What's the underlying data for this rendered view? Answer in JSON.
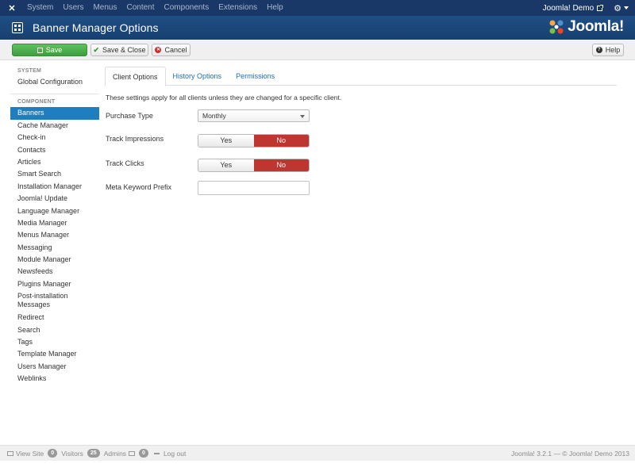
{
  "navbar": {
    "menu": [
      "System",
      "Users",
      "Menus",
      "Content",
      "Components",
      "Extensions",
      "Help"
    ],
    "site_link": "Joomla! Demo"
  },
  "header": {
    "title": "Banner Manager Options",
    "brand": "Joomla!"
  },
  "toolbar": {
    "save": "Save",
    "save_close": "Save & Close",
    "cancel": "Cancel",
    "help": "Help"
  },
  "sidebar": {
    "system_heading": "SYSTEM",
    "system_items": [
      "Global Configuration"
    ],
    "component_heading": "COMPONENT",
    "components": [
      "Banners",
      "Cache Manager",
      "Check-in",
      "Contacts",
      "Articles",
      "Smart Search",
      "Installation Manager",
      "Joomla! Update",
      "Language Manager",
      "Media Manager",
      "Menus Manager",
      "Messaging",
      "Module Manager",
      "Newsfeeds",
      "Plugins Manager",
      "Post-installation Messages",
      "Redirect",
      "Search",
      "Tags",
      "Template Manager",
      "Users Manager",
      "Weblinks"
    ],
    "active": "Banners"
  },
  "tabs": [
    "Client Options",
    "History Options",
    "Permissions"
  ],
  "form": {
    "description": "These settings apply for all clients unless they are changed for a specific client.",
    "purchase_type_label": "Purchase Type",
    "purchase_type_value": "Monthly",
    "track_impressions_label": "Track Impressions",
    "track_clicks_label": "Track Clicks",
    "yes": "Yes",
    "no": "No",
    "meta_keyword_label": "Meta Keyword Prefix",
    "meta_keyword_value": ""
  },
  "footer": {
    "view_site": "View Site",
    "visitors_count": "0",
    "visitors": "Visitors",
    "admins_count": "25",
    "admins": "Admins",
    "messages_count": "0",
    "logout": "Log out",
    "copyright": "Joomla! 3.2.1 — © Joomla! Demo 2013"
  },
  "colors": {
    "navbar": "#1a3867",
    "header": "#1f4f86",
    "save_green": "#4cae4c",
    "active_blue": "#1e7ec2",
    "toggle_red": "#bd362f"
  }
}
